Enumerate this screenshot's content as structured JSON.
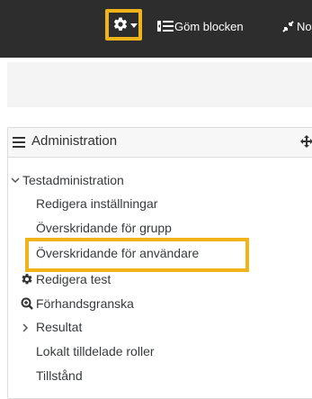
{
  "topbar": {
    "gear": {
      "icon": "gear-icon",
      "caret": "chevron-down-icon"
    },
    "hide_blocks": {
      "label": "Göm blocken",
      "icon": "hide-blocks-icon"
    },
    "fullscreen": {
      "label": "No",
      "icon": "fullscreen-icon"
    }
  },
  "admin_block": {
    "title": "Administration",
    "menu_icon": "hamburger-icon",
    "move_icon": "move-icon",
    "tree": {
      "root": {
        "label": "Testadministration",
        "expanded": true
      },
      "items": [
        {
          "label": "Redigera inställningar"
        },
        {
          "label": "Överskridande för grupp"
        },
        {
          "label": "Överskridande för användare",
          "highlighted": true
        },
        {
          "label": "Redigera test",
          "icon": "gear-icon"
        },
        {
          "label": "Förhandsgranska",
          "icon": "preview-icon"
        },
        {
          "label": "Resultat",
          "collapsed": true
        },
        {
          "label": "Lokalt tilldelade roller"
        },
        {
          "label": "Tillstånd"
        }
      ]
    }
  },
  "colors": {
    "topbar_bg": "#2d2d2d",
    "highlight": "#f0b31a",
    "text": "#373a3c"
  }
}
